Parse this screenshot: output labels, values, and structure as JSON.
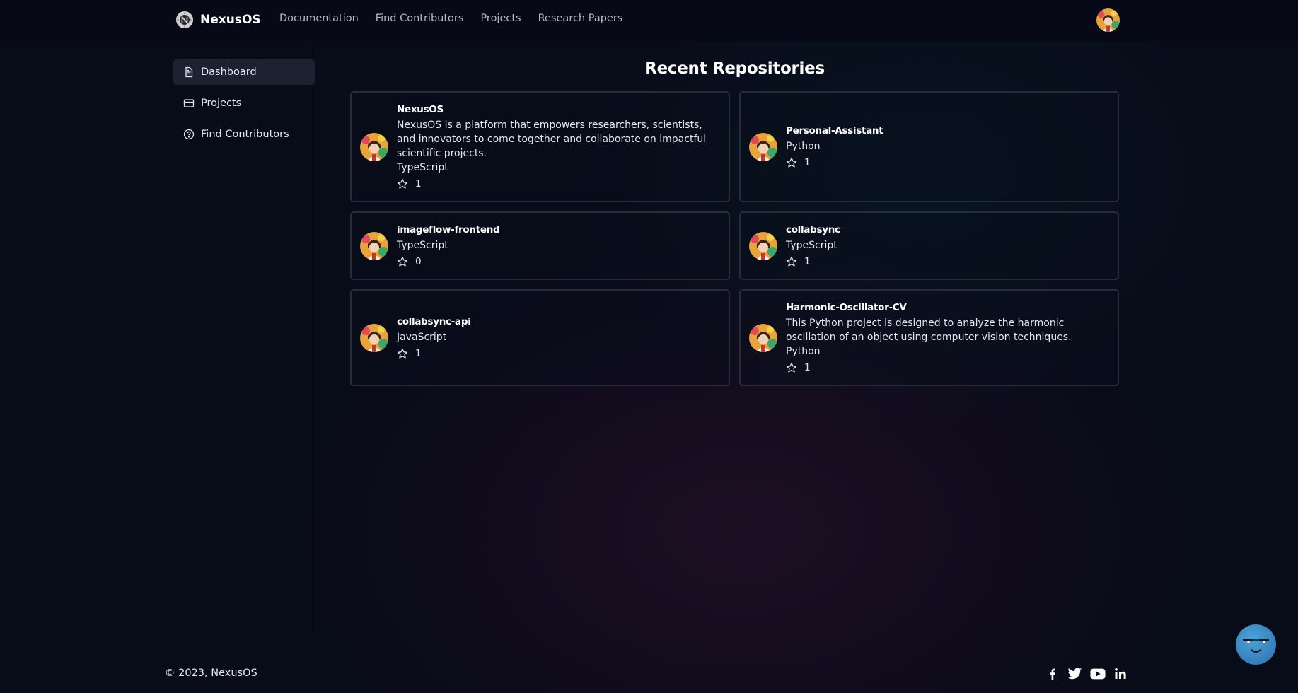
{
  "header": {
    "brand": "NexusOS",
    "nav": [
      "Documentation",
      "Find Contributors",
      "Projects",
      "Research Papers"
    ]
  },
  "sidebar": {
    "items": [
      {
        "label": "Dashboard",
        "icon": "document-icon",
        "active": true
      },
      {
        "label": "Projects",
        "icon": "card-icon",
        "active": false
      },
      {
        "label": "Find Contributors",
        "icon": "help-circle-icon",
        "active": false
      }
    ]
  },
  "main": {
    "title": "Recent Repositories",
    "repos": [
      {
        "name": "NexusOS",
        "description": "NexusOS is a platform that empowers researchers, scientists, and innovators to come together and collaborate on impactful scientific projects.",
        "language": "TypeScript",
        "stars": "1"
      },
      {
        "name": "Personal-Assistant",
        "description": "",
        "language": "Python",
        "stars": "1"
      },
      {
        "name": "imageflow-frontend",
        "description": "",
        "language": "TypeScript",
        "stars": "0"
      },
      {
        "name": "collabsync",
        "description": "",
        "language": "TypeScript",
        "stars": "1"
      },
      {
        "name": "collabsync-api",
        "description": "",
        "language": "JavaScript",
        "stars": "1"
      },
      {
        "name": "Harmonic-Oscillator-CV",
        "description": "This Python project is designed to analyze the harmonic oscillation of an object using computer vision techniques.",
        "language": "Python",
        "stars": "1"
      }
    ]
  },
  "footer": {
    "copyright": "© 2023, NexusOS",
    "socials": [
      "facebook-icon",
      "twitter-icon",
      "youtube-icon",
      "linkedin-icon"
    ]
  },
  "colors": {
    "background": "#080b18",
    "card_border": "#262c3b",
    "active_item": "#1c2232",
    "chat_bot": "#3a8cc8"
  }
}
